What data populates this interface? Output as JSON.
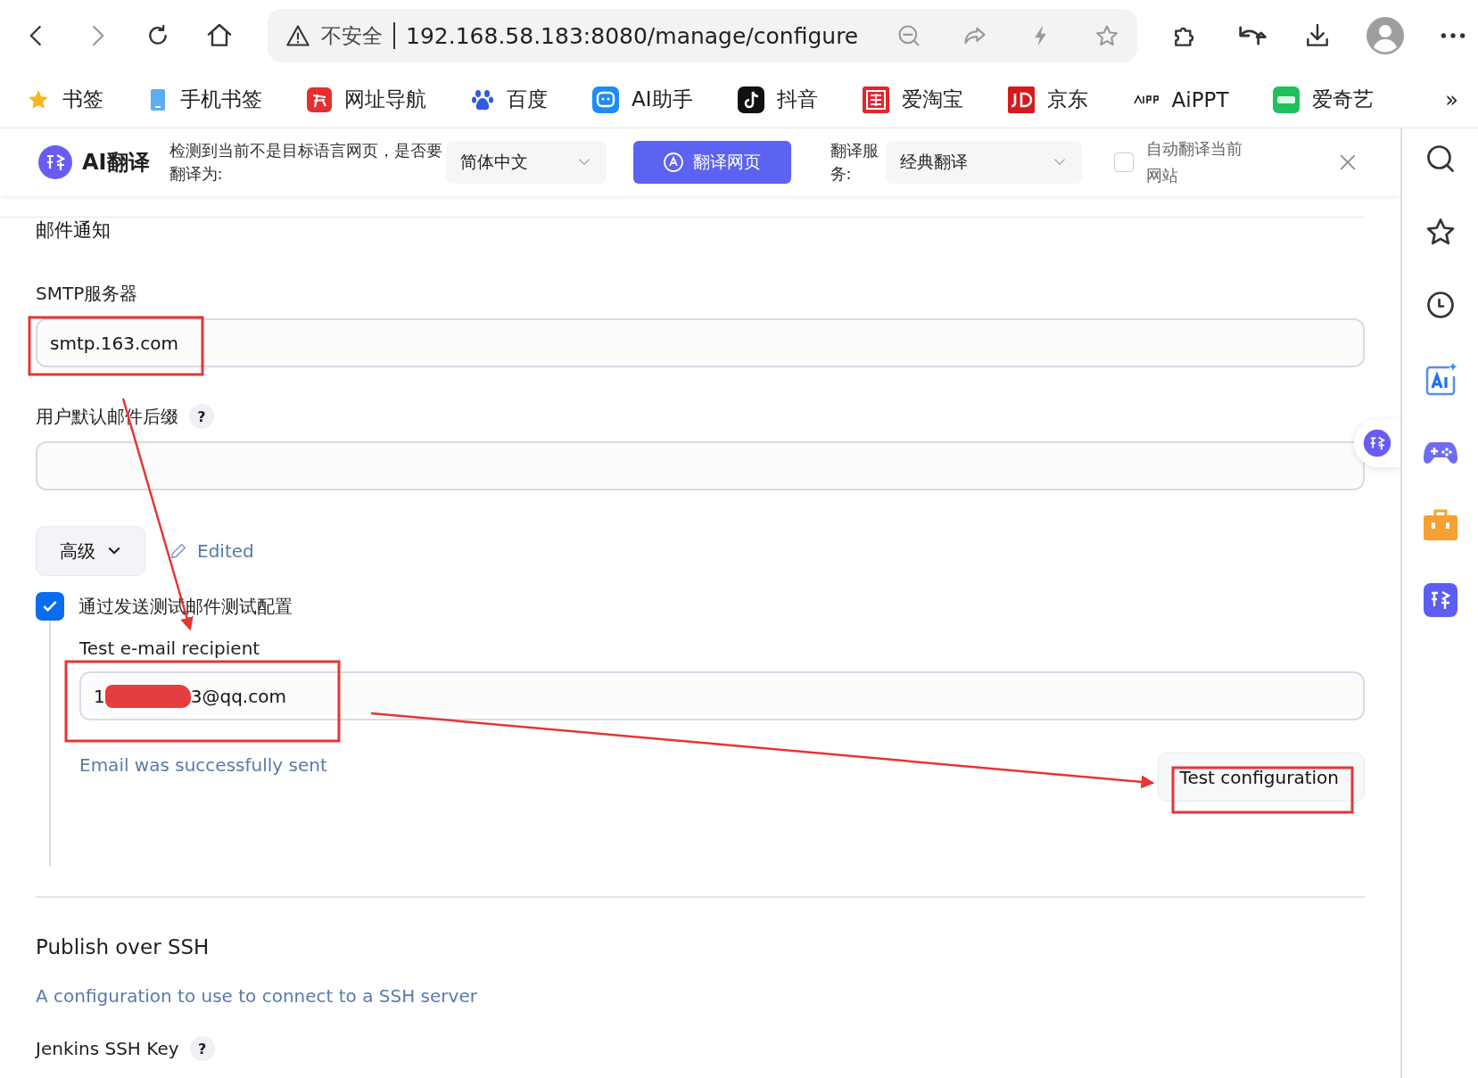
{
  "browser": {
    "security_warning": "不安全",
    "url": "192.168.58.183:8080/manage/configure"
  },
  "bookmarks": [
    {
      "label": "书签"
    },
    {
      "label": "手机书签"
    },
    {
      "label": "网址导航"
    },
    {
      "label": "百度"
    },
    {
      "label": "AI助手"
    },
    {
      "label": "抖音"
    },
    {
      "label": "爱淘宝"
    },
    {
      "label": "京东"
    },
    {
      "label": "AiPPT"
    },
    {
      "label": "爱奇艺"
    }
  ],
  "bookmarks_more": "»",
  "translate_bar": {
    "logo": "AI翻译",
    "prompt": "检测到当前不是目标语言网页，是否要翻译为:",
    "language": "简体中文",
    "translate_button": "翻译网页",
    "service_label": "翻译服务:",
    "service": "经典翻译",
    "auto_translate": {
      "label": "自动翻译当前网站",
      "checked": false
    }
  },
  "section_title": "邮件通知",
  "fields": [
    {
      "label": "SMTP服务器",
      "value": "smtp.163.com"
    },
    {
      "label": "用户默认邮件后缀",
      "help_mark": "?"
    }
  ],
  "advanced": {
    "label": "高级",
    "edited": "Edited"
  },
  "test_option": {
    "label": "通过发送测试邮件测试配置",
    "checked": true
  },
  "test": {
    "label": "Test e-mail recipient",
    "value_start": "1",
    "value_end": "3@qq.com",
    "status": "Email was successfully sent",
    "button": "Test configuration"
  },
  "ssh": {
    "title": "Publish over SSH",
    "description": "A configuration to use to connect to a SSH server",
    "key_label": "Jenkins SSH Key",
    "help_mark": "?"
  }
}
